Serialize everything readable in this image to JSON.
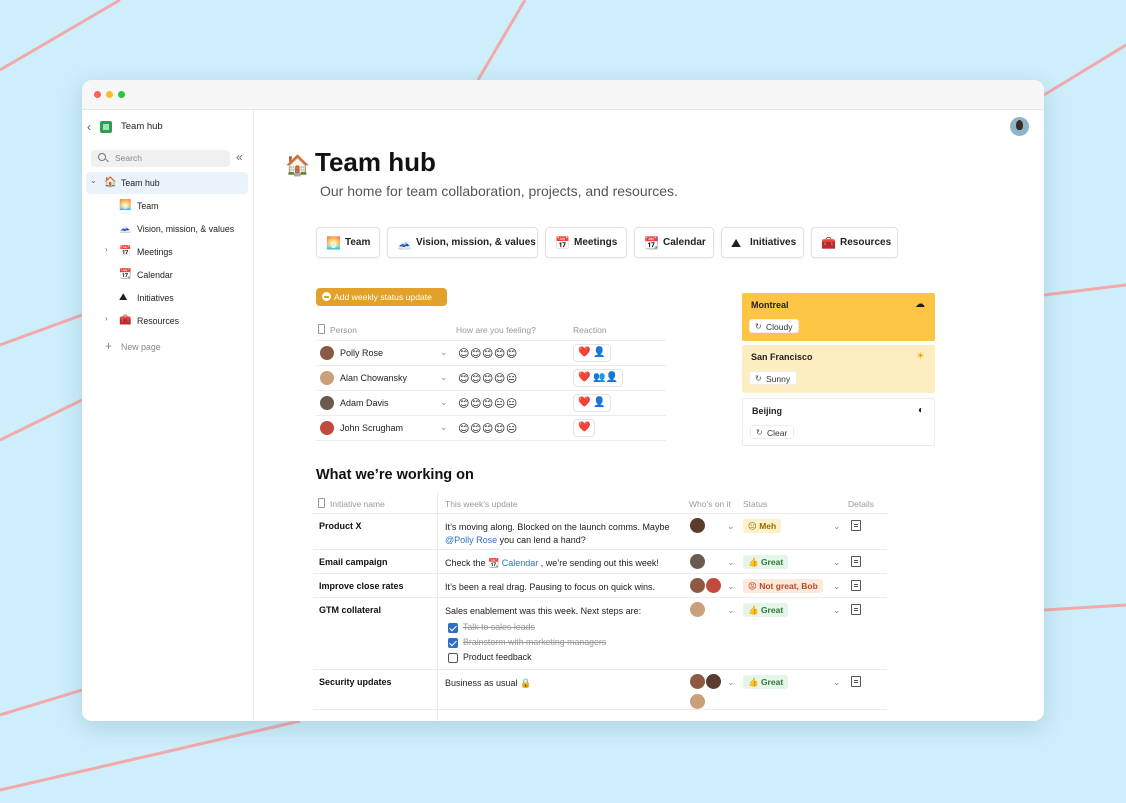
{
  "sidebar": {
    "workspace": "Team hub",
    "search_placeholder": "Search",
    "items": [
      {
        "label": "Team hub",
        "icon": "🏠"
      },
      {
        "label": "Team",
        "icon": "🌅"
      },
      {
        "label": "Vision, mission, & values",
        "icon": "🗻"
      },
      {
        "label": "Meetings",
        "icon": "📅"
      },
      {
        "label": "Calendar",
        "icon": "📆"
      },
      {
        "label": "Initiatives",
        "icon": "⛰"
      },
      {
        "label": "Resources",
        "icon": "🧰"
      },
      {
        "label": "New page",
        "icon": "+"
      }
    ]
  },
  "page": {
    "icon": "🏠",
    "title": "Team hub",
    "subtitle": "Our home for team collaboration, projects, and resources."
  },
  "cards": [
    {
      "label": "Team",
      "icon": "🌅"
    },
    {
      "label": "Vision, mission, & values",
      "icon": "🗻"
    },
    {
      "label": "Meetings",
      "icon": "📅"
    },
    {
      "label": "Calendar",
      "icon": "📆"
    },
    {
      "label": "Initiatives",
      "icon": "⛰"
    },
    {
      "label": "Resources",
      "icon": "🧰"
    }
  ],
  "status": {
    "button": "Add weekly status update",
    "headers": {
      "person": "Person",
      "feeling": "How are you feeling?",
      "reaction": "Reaction"
    },
    "rows": [
      {
        "name": "Polly Rose",
        "faces": "😊😊😊😊😊",
        "reaction": "❤️ 👤"
      },
      {
        "name": "Alan Chowansky",
        "faces": "😊😊😊😊😐",
        "reaction": "❤️ 👥👤"
      },
      {
        "name": "Adam Davis",
        "faces": "😊😊😊😐😐",
        "reaction": "❤️ 👤"
      },
      {
        "name": "John Scrugham",
        "faces": "😊😊😊😊😐",
        "reaction": "❤️"
      }
    ]
  },
  "weather": [
    {
      "city": "Montreal",
      "condition": "Cloudy",
      "icon": "☁",
      "color": "#fdc544"
    },
    {
      "city": "San Francisco",
      "condition": "Sunny",
      "icon": "☀",
      "color": "#fdeec2"
    },
    {
      "city": "Beijing",
      "condition": "Clear",
      "icon": "◐",
      "color": "#ffffff"
    }
  ],
  "working": {
    "title": "What we’re working on",
    "headers": {
      "initiative": "Initiative name",
      "update": "This week’s update",
      "who": "Who’s on it",
      "status": "Status",
      "details": "Details"
    },
    "rows": [
      {
        "name": "Product X",
        "update_pre": "It’s moving along. Blocked on the launch comms. Maybe ",
        "mention": "@Polly Rose",
        "update_post": " you can lend a hand?",
        "status": "😐 Meh"
      },
      {
        "name": "Email campaign",
        "update_pre": "Check the ",
        "mention": "📆 Calendar",
        "update_post": " , we’re sending out this week!",
        "status": "👍 Great"
      },
      {
        "name": "Improve close rates",
        "update": "It’s been a real drag. Pausing to focus on quick wins.",
        "status": "😡 Not great, Bob"
      },
      {
        "name": "GTM collateral",
        "update": "Sales enablement was this week. Next steps are:",
        "status": "👍 Great",
        "todos": [
          "Talk to sales leads",
          "Brainstorm with marketing managers",
          "Product feedback"
        ]
      },
      {
        "name": "Security updates",
        "update": "Business as usual 🔒",
        "status": "👍 Great"
      }
    ]
  }
}
